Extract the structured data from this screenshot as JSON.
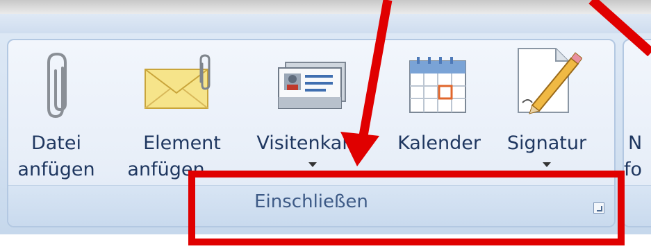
{
  "group": {
    "title": "Einschließen",
    "buttons": [
      {
        "line1": "Datei",
        "line2": "anfügen",
        "icon": "paperclip-icon"
      },
      {
        "line1": "Element",
        "line2": "anfügen",
        "icon": "envelope-attachment-icon"
      },
      {
        "line1": "Visitenkarte",
        "line2": "",
        "icon": "business-card-icon"
      },
      {
        "line1": "Kalender",
        "line2": "",
        "icon": "calendar-icon"
      },
      {
        "line1": "Signatur",
        "line2": "",
        "icon": "signature-icon"
      }
    ]
  },
  "next_group": {
    "line1": "N",
    "line2": "fo"
  },
  "colors": {
    "annotation": "#e00000",
    "label_text": "#1f3760",
    "group_title": "#3d5a86"
  }
}
